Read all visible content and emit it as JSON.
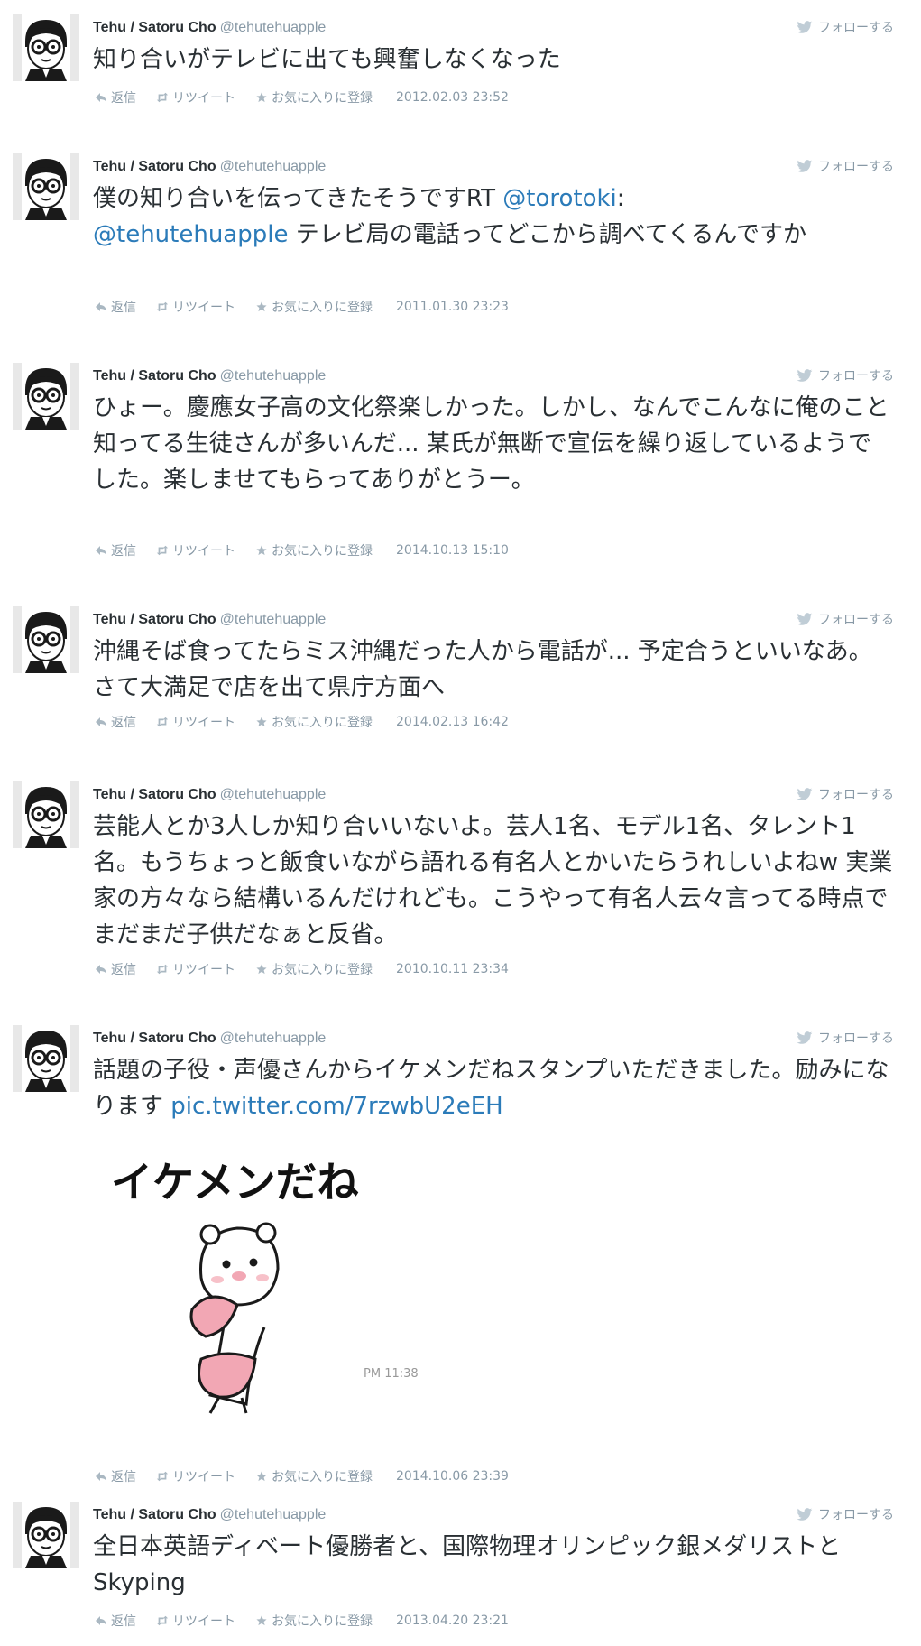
{
  "follow_label": "フォローする",
  "actions": {
    "reply": "返信",
    "retweet": "リツイート",
    "favorite": "お気に入りに登録"
  },
  "colors": {
    "link": "#2b7bb9",
    "meta": "#8899a6",
    "text": "#292f33"
  },
  "tweets": [
    {
      "name": "Tehu / Satoru Cho",
      "handle": "@tehutehuapple",
      "text": "知り合いがテレビに出ても興奮しなくなった",
      "date": "2012.02.03 23:52"
    },
    {
      "name": "Tehu / Satoru Cho",
      "handle": "@tehutehuapple",
      "text_a": "僕の知り合いを伝ってきたそうですRT ",
      "mention1": "@torotoki",
      "text_b": ":",
      "mention2": "@tehutehuapple",
      "text_c": " テレビ局の電話ってどこから調べてくるんですか",
      "date": "2011.01.30 23:23"
    },
    {
      "name": "Tehu / Satoru Cho",
      "handle": "@tehutehuapple",
      "text": "ひょー。慶應女子高の文化祭楽しかった。しかし、なんでこんなに俺のこと知ってる生徒さんが多いんだ... 某氏が無断で宣伝を繰り返しているようでした。楽しませてもらってありがとうー。",
      "date": "2014.10.13 15:10"
    },
    {
      "name": "Tehu / Satoru Cho",
      "handle": "@tehutehuapple",
      "text": "沖縄そば食ってたらミス沖縄だった人から電話が... 予定合うといいなあ。さて大満足で店を出て県庁方面へ",
      "date": "2014.02.13 16:42"
    },
    {
      "name": "Tehu / Satoru Cho",
      "handle": "@tehutehuapple",
      "text": "芸能人とか3人しか知り合いいないよ。芸人1名、モデル1名、タレント1名。もうちょっと飯食いながら語れる有名人とかいたらうれしいよねw 実業家の方々なら結構いるんだけれども。こうやって有名人云々言ってる時点でまだまだ子供だなぁと反省。",
      "date": "2010.10.11 23:34"
    },
    {
      "name": "Tehu / Satoru Cho",
      "handle": "@tehutehuapple",
      "text": "話題の子役・声優さんからイケメンだねスタンプいただきました。励みになります ",
      "link": "pic.twitter.com/7rzwbU2eEH",
      "image_caption": "イケメンだね",
      "image_time": "PM 11:38",
      "date": "2014.10.06 23:39"
    },
    {
      "name": "Tehu / Satoru Cho",
      "handle": "@tehutehuapple",
      "text": "全日本英語ディベート優勝者と、国際物理オリンピック銀メダリストとSkyping",
      "date": "2013.04.20 23:21"
    }
  ]
}
